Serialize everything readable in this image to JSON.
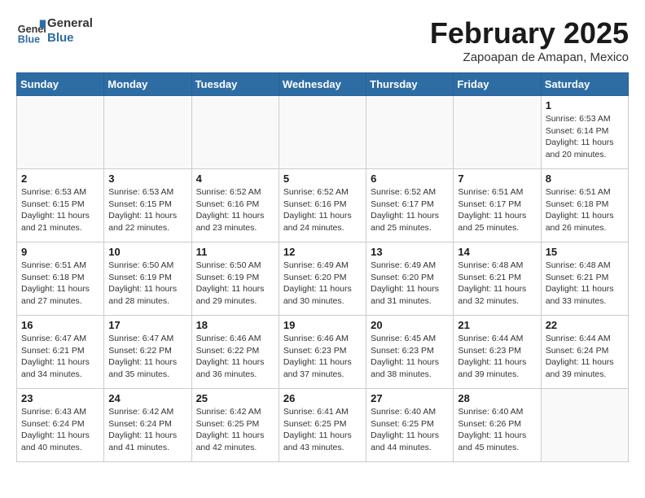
{
  "header": {
    "logo_line1": "General",
    "logo_line2": "Blue",
    "title": "February 2025",
    "subtitle": "Zapoapan de Amapan, Mexico"
  },
  "days_of_week": [
    "Sunday",
    "Monday",
    "Tuesday",
    "Wednesday",
    "Thursday",
    "Friday",
    "Saturday"
  ],
  "weeks": [
    [
      {
        "day": "",
        "info": ""
      },
      {
        "day": "",
        "info": ""
      },
      {
        "day": "",
        "info": ""
      },
      {
        "day": "",
        "info": ""
      },
      {
        "day": "",
        "info": ""
      },
      {
        "day": "",
        "info": ""
      },
      {
        "day": "1",
        "info": "Sunrise: 6:53 AM\nSunset: 6:14 PM\nDaylight: 11 hours\nand 20 minutes."
      }
    ],
    [
      {
        "day": "2",
        "info": "Sunrise: 6:53 AM\nSunset: 6:15 PM\nDaylight: 11 hours\nand 21 minutes."
      },
      {
        "day": "3",
        "info": "Sunrise: 6:53 AM\nSunset: 6:15 PM\nDaylight: 11 hours\nand 22 minutes."
      },
      {
        "day": "4",
        "info": "Sunrise: 6:52 AM\nSunset: 6:16 PM\nDaylight: 11 hours\nand 23 minutes."
      },
      {
        "day": "5",
        "info": "Sunrise: 6:52 AM\nSunset: 6:16 PM\nDaylight: 11 hours\nand 24 minutes."
      },
      {
        "day": "6",
        "info": "Sunrise: 6:52 AM\nSunset: 6:17 PM\nDaylight: 11 hours\nand 25 minutes."
      },
      {
        "day": "7",
        "info": "Sunrise: 6:51 AM\nSunset: 6:17 PM\nDaylight: 11 hours\nand 25 minutes."
      },
      {
        "day": "8",
        "info": "Sunrise: 6:51 AM\nSunset: 6:18 PM\nDaylight: 11 hours\nand 26 minutes."
      }
    ],
    [
      {
        "day": "9",
        "info": "Sunrise: 6:51 AM\nSunset: 6:18 PM\nDaylight: 11 hours\nand 27 minutes."
      },
      {
        "day": "10",
        "info": "Sunrise: 6:50 AM\nSunset: 6:19 PM\nDaylight: 11 hours\nand 28 minutes."
      },
      {
        "day": "11",
        "info": "Sunrise: 6:50 AM\nSunset: 6:19 PM\nDaylight: 11 hours\nand 29 minutes."
      },
      {
        "day": "12",
        "info": "Sunrise: 6:49 AM\nSunset: 6:20 PM\nDaylight: 11 hours\nand 30 minutes."
      },
      {
        "day": "13",
        "info": "Sunrise: 6:49 AM\nSunset: 6:20 PM\nDaylight: 11 hours\nand 31 minutes."
      },
      {
        "day": "14",
        "info": "Sunrise: 6:48 AM\nSunset: 6:21 PM\nDaylight: 11 hours\nand 32 minutes."
      },
      {
        "day": "15",
        "info": "Sunrise: 6:48 AM\nSunset: 6:21 PM\nDaylight: 11 hours\nand 33 minutes."
      }
    ],
    [
      {
        "day": "16",
        "info": "Sunrise: 6:47 AM\nSunset: 6:21 PM\nDaylight: 11 hours\nand 34 minutes."
      },
      {
        "day": "17",
        "info": "Sunrise: 6:47 AM\nSunset: 6:22 PM\nDaylight: 11 hours\nand 35 minutes."
      },
      {
        "day": "18",
        "info": "Sunrise: 6:46 AM\nSunset: 6:22 PM\nDaylight: 11 hours\nand 36 minutes."
      },
      {
        "day": "19",
        "info": "Sunrise: 6:46 AM\nSunset: 6:23 PM\nDaylight: 11 hours\nand 37 minutes."
      },
      {
        "day": "20",
        "info": "Sunrise: 6:45 AM\nSunset: 6:23 PM\nDaylight: 11 hours\nand 38 minutes."
      },
      {
        "day": "21",
        "info": "Sunrise: 6:44 AM\nSunset: 6:23 PM\nDaylight: 11 hours\nand 39 minutes."
      },
      {
        "day": "22",
        "info": "Sunrise: 6:44 AM\nSunset: 6:24 PM\nDaylight: 11 hours\nand 39 minutes."
      }
    ],
    [
      {
        "day": "23",
        "info": "Sunrise: 6:43 AM\nSunset: 6:24 PM\nDaylight: 11 hours\nand 40 minutes."
      },
      {
        "day": "24",
        "info": "Sunrise: 6:42 AM\nSunset: 6:24 PM\nDaylight: 11 hours\nand 41 minutes."
      },
      {
        "day": "25",
        "info": "Sunrise: 6:42 AM\nSunset: 6:25 PM\nDaylight: 11 hours\nand 42 minutes."
      },
      {
        "day": "26",
        "info": "Sunrise: 6:41 AM\nSunset: 6:25 PM\nDaylight: 11 hours\nand 43 minutes."
      },
      {
        "day": "27",
        "info": "Sunrise: 6:40 AM\nSunset: 6:25 PM\nDaylight: 11 hours\nand 44 minutes."
      },
      {
        "day": "28",
        "info": "Sunrise: 6:40 AM\nSunset: 6:26 PM\nDaylight: 11 hours\nand 45 minutes."
      },
      {
        "day": "",
        "info": ""
      }
    ]
  ]
}
